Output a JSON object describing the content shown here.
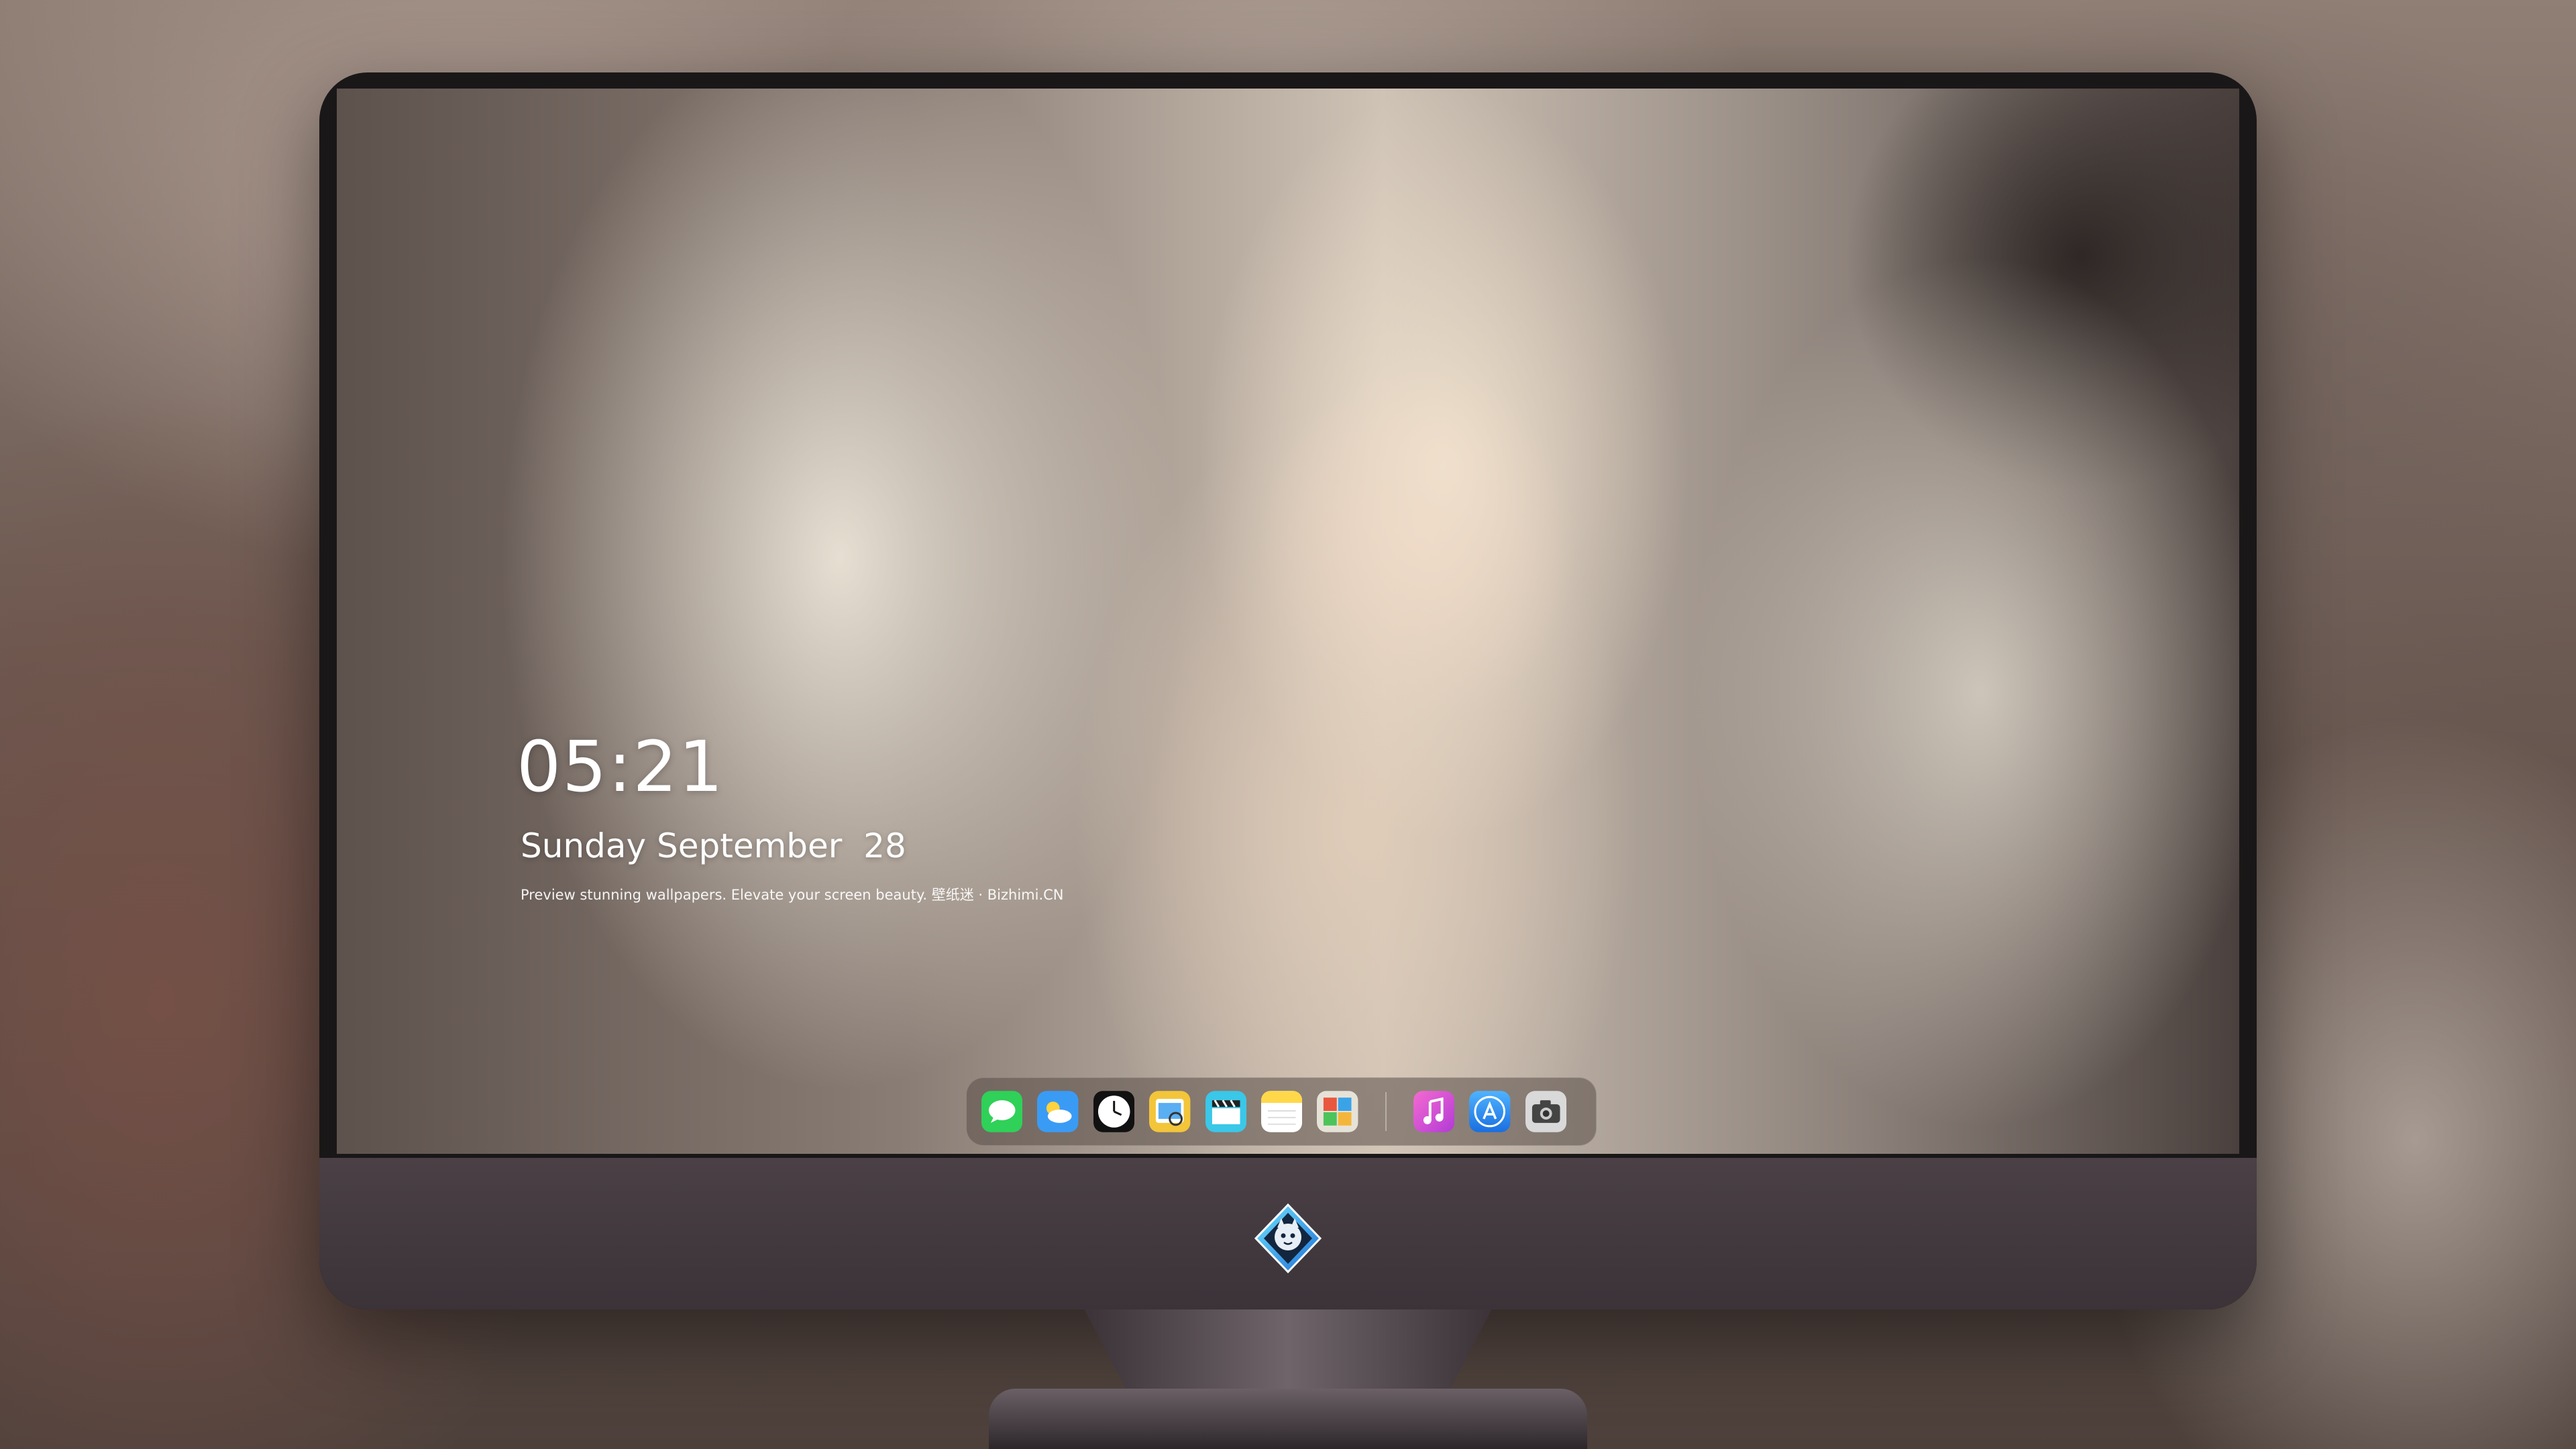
{
  "lock_screen": {
    "time": "05:21",
    "date": "Sunday September  28",
    "tagline": "Preview stunning wallpapers. Elevate your screen beauty. 壁纸迷 · Bizhimi.CN"
  },
  "dock": {
    "apps": [
      {
        "name": "messages-icon",
        "color": "#2fd158"
      },
      {
        "name": "weather-icon",
        "color": "#3a9bf5"
      },
      {
        "name": "clock-icon",
        "color": "#111111"
      },
      {
        "name": "preview-icon",
        "color": "#f3c53a"
      },
      {
        "name": "clips-icon",
        "color": "#3ac7e8"
      },
      {
        "name": "notes-icon",
        "color": "#ffd84a"
      },
      {
        "name": "photo-booth-icon",
        "color": "#e7e2d8"
      }
    ],
    "pinned_apps": [
      {
        "name": "itunes-icon",
        "color": "#e94cd6"
      },
      {
        "name": "app-store-icon",
        "color": "#2d8cf0"
      },
      {
        "name": "camera-icon",
        "color": "#5a5a5a"
      }
    ]
  },
  "colors": {
    "frame": "#1a1718",
    "chin": "#433a3f",
    "text": "#ffffff"
  }
}
